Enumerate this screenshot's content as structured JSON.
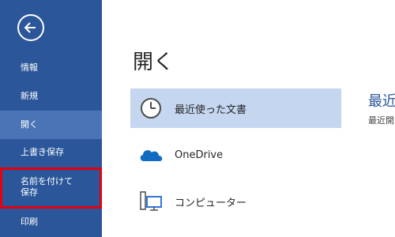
{
  "sidebar": {
    "back_icon": "back-arrow-icon",
    "items": [
      {
        "label": "情報"
      },
      {
        "label": "新規"
      },
      {
        "label": "開く"
      },
      {
        "label": "上書き保存"
      },
      {
        "label": "名前を付けて\n保存"
      },
      {
        "label": "印刷"
      }
    ]
  },
  "main": {
    "title": "開く",
    "places": [
      {
        "label": "最近使った文書",
        "icon": "clock-icon"
      },
      {
        "label": "OneDrive",
        "icon": "cloud-icon"
      },
      {
        "label": "コンピューター",
        "icon": "computer-icon"
      }
    ]
  },
  "right": {
    "title": "最近",
    "subtitle": "最近開"
  },
  "colors": {
    "sidebar_bg": "#2b579a",
    "sidebar_selected": "#4a74b6",
    "place_selected": "#c5d6f0",
    "highlight_box": "#e3000f",
    "onedrive_blue": "#0f6cc0"
  }
}
